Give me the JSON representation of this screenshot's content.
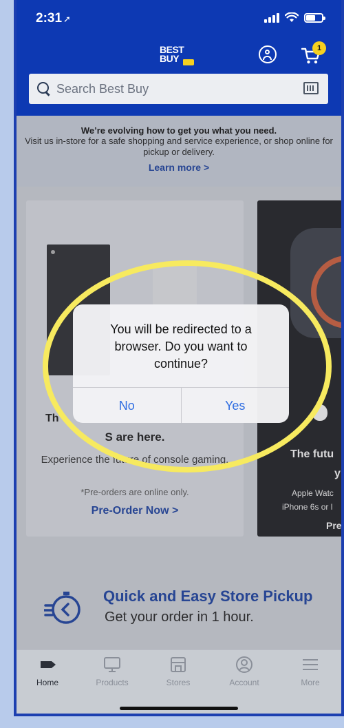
{
  "status": {
    "time": "2:31",
    "location_icon": "location-arrow-icon"
  },
  "header": {
    "logo_text": "BEST BUY",
    "cart_count": "1",
    "search_placeholder": "Search Best Buy"
  },
  "banner": {
    "title": "We’re evolving how to get you what you need.",
    "body": "Visit us in-store for a safe shopping and service experience, or shop online for pickup or delivery.",
    "link": "Learn more >"
  },
  "cards": {
    "left": {
      "line1": "Th",
      "line2": "S are here.",
      "line3": "Experience the future of console gaming.",
      "line4": "*Pre-orders are online only.",
      "link": "Pre-Order Now >"
    },
    "right": {
      "line1": "The futu",
      "line2": "y",
      "line3": "Apple Watc",
      "line4": "iPhone 6s or l",
      "link": "Pre"
    }
  },
  "pickup": {
    "title": "Quick and Easy Store Pickup",
    "subtitle": "Get your order in 1 hour."
  },
  "dialog": {
    "message": "You will be redirected to a browser. Do you want to continue?",
    "no_label": "No",
    "yes_label": "Yes"
  },
  "tabs": [
    {
      "label": "Home",
      "icon": "tag-icon"
    },
    {
      "label": "Products",
      "icon": "monitor-icon"
    },
    {
      "label": "Stores",
      "icon": "store-icon"
    },
    {
      "label": "Account",
      "icon": "account-icon"
    },
    {
      "label": "More",
      "icon": "menu-icon"
    }
  ],
  "colors": {
    "brand_blue": "#0d39b3",
    "brand_yellow": "#f5d020",
    "link_blue": "#1a3f9c",
    "ios_blue": "#2f6de1",
    "highlight_yellow": "#f7ea5f"
  }
}
